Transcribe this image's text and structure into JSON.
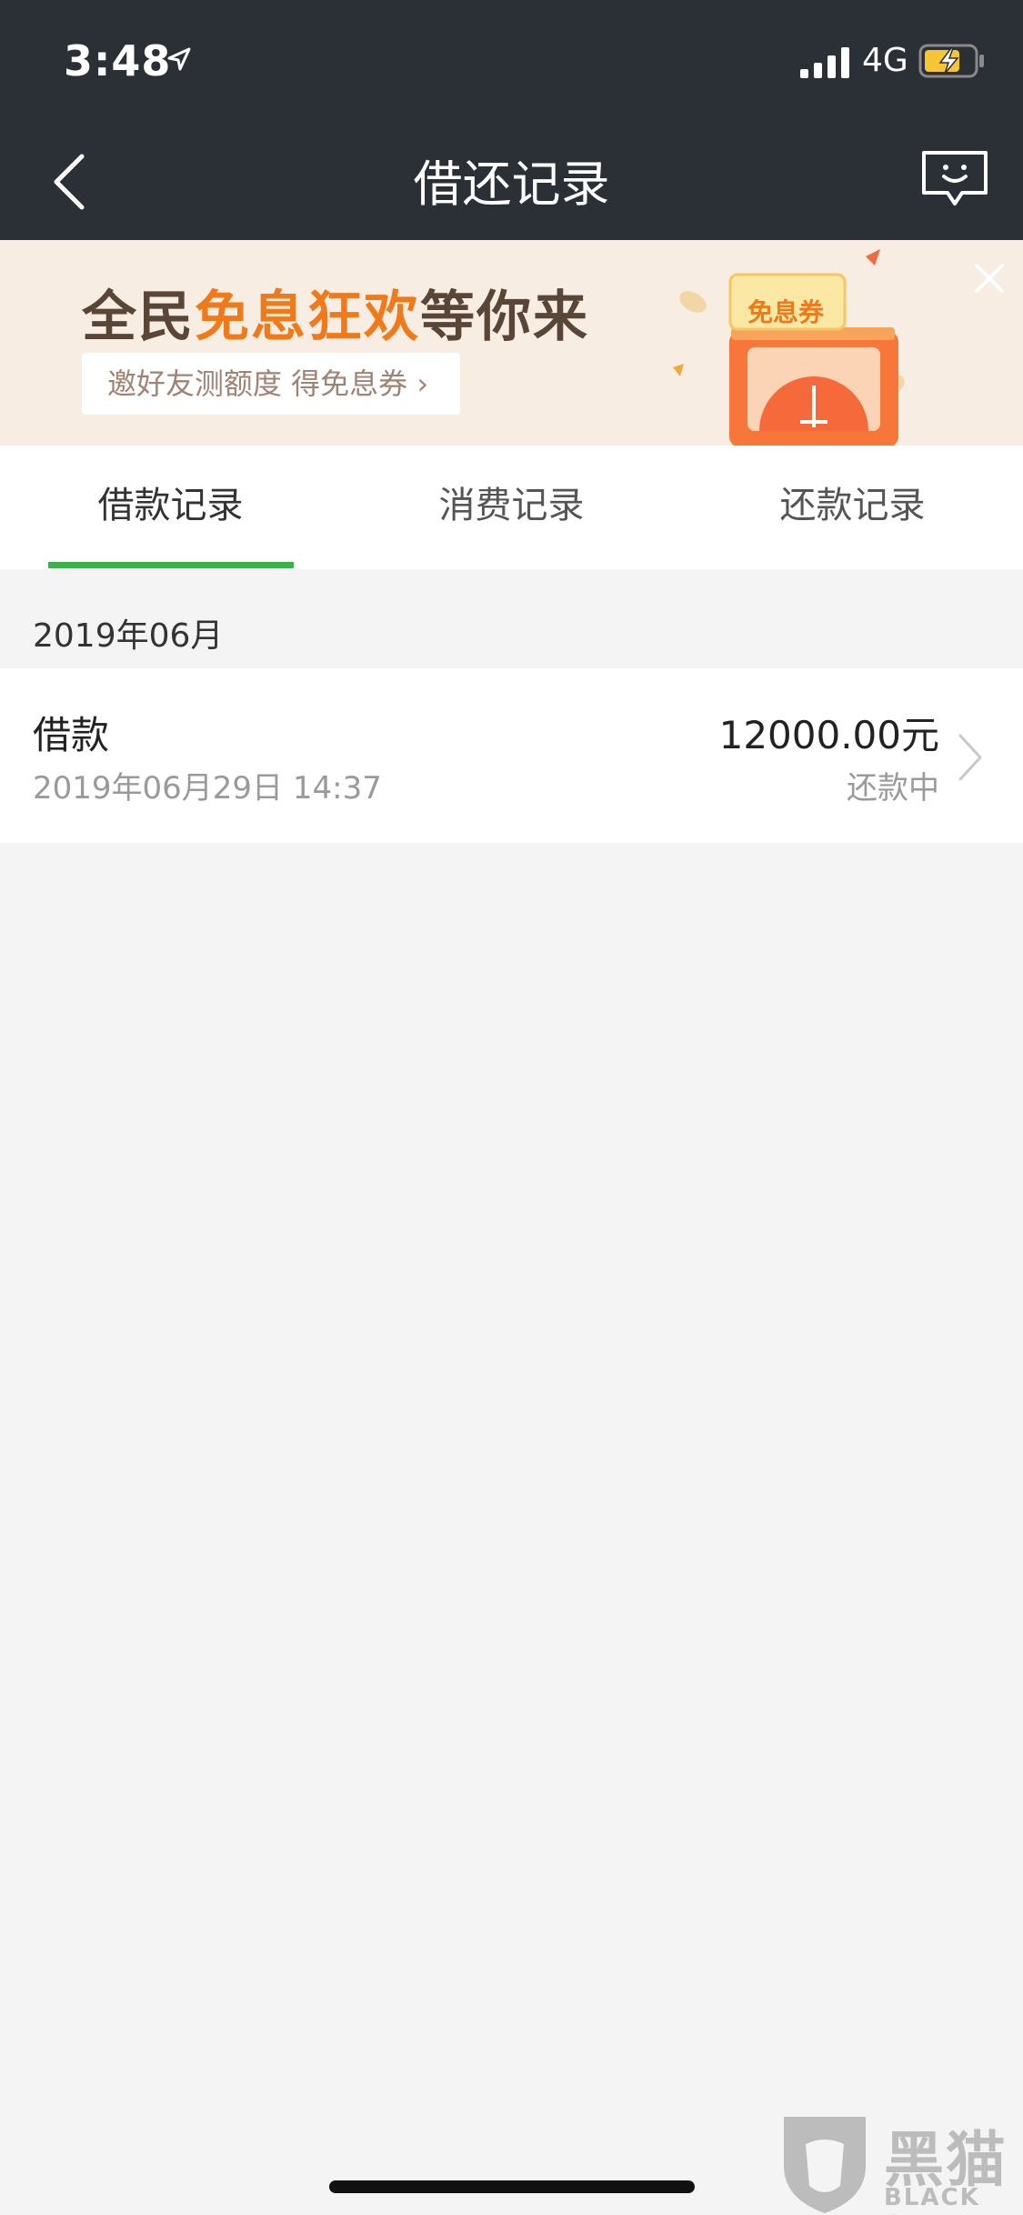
{
  "status_bar": {
    "time": "3:48",
    "network": "4G",
    "icons": [
      "location-arrow-icon",
      "signal-icon",
      "battery-charging-icon"
    ]
  },
  "nav": {
    "title": "借还记录",
    "back_icon": "chevron-left-icon",
    "service_icon": "chat-bubble-smile-icon"
  },
  "banner": {
    "headline_prefix": "全民",
    "headline_highlight": "免息狂欢",
    "headline_suffix": "等你来",
    "sub_label": "邀好友测额度 得免息券 ›",
    "coupon_label": "免息券",
    "close_icon": "close-icon",
    "accent_color": "#f07a1a"
  },
  "tabs": [
    {
      "label": "借款记录",
      "active": true
    },
    {
      "label": "消费记录",
      "active": false
    },
    {
      "label": "还款记录",
      "active": false
    }
  ],
  "active_tab_color": "#3ab14a",
  "records": {
    "month": "2019年06月",
    "items": [
      {
        "type": "借款",
        "datetime": "2019年06月29日 14:37",
        "amount": "12000.00元",
        "status": "还款中"
      }
    ]
  },
  "watermark": {
    "cn": "黑猫",
    "en": "BLACK CAT"
  }
}
